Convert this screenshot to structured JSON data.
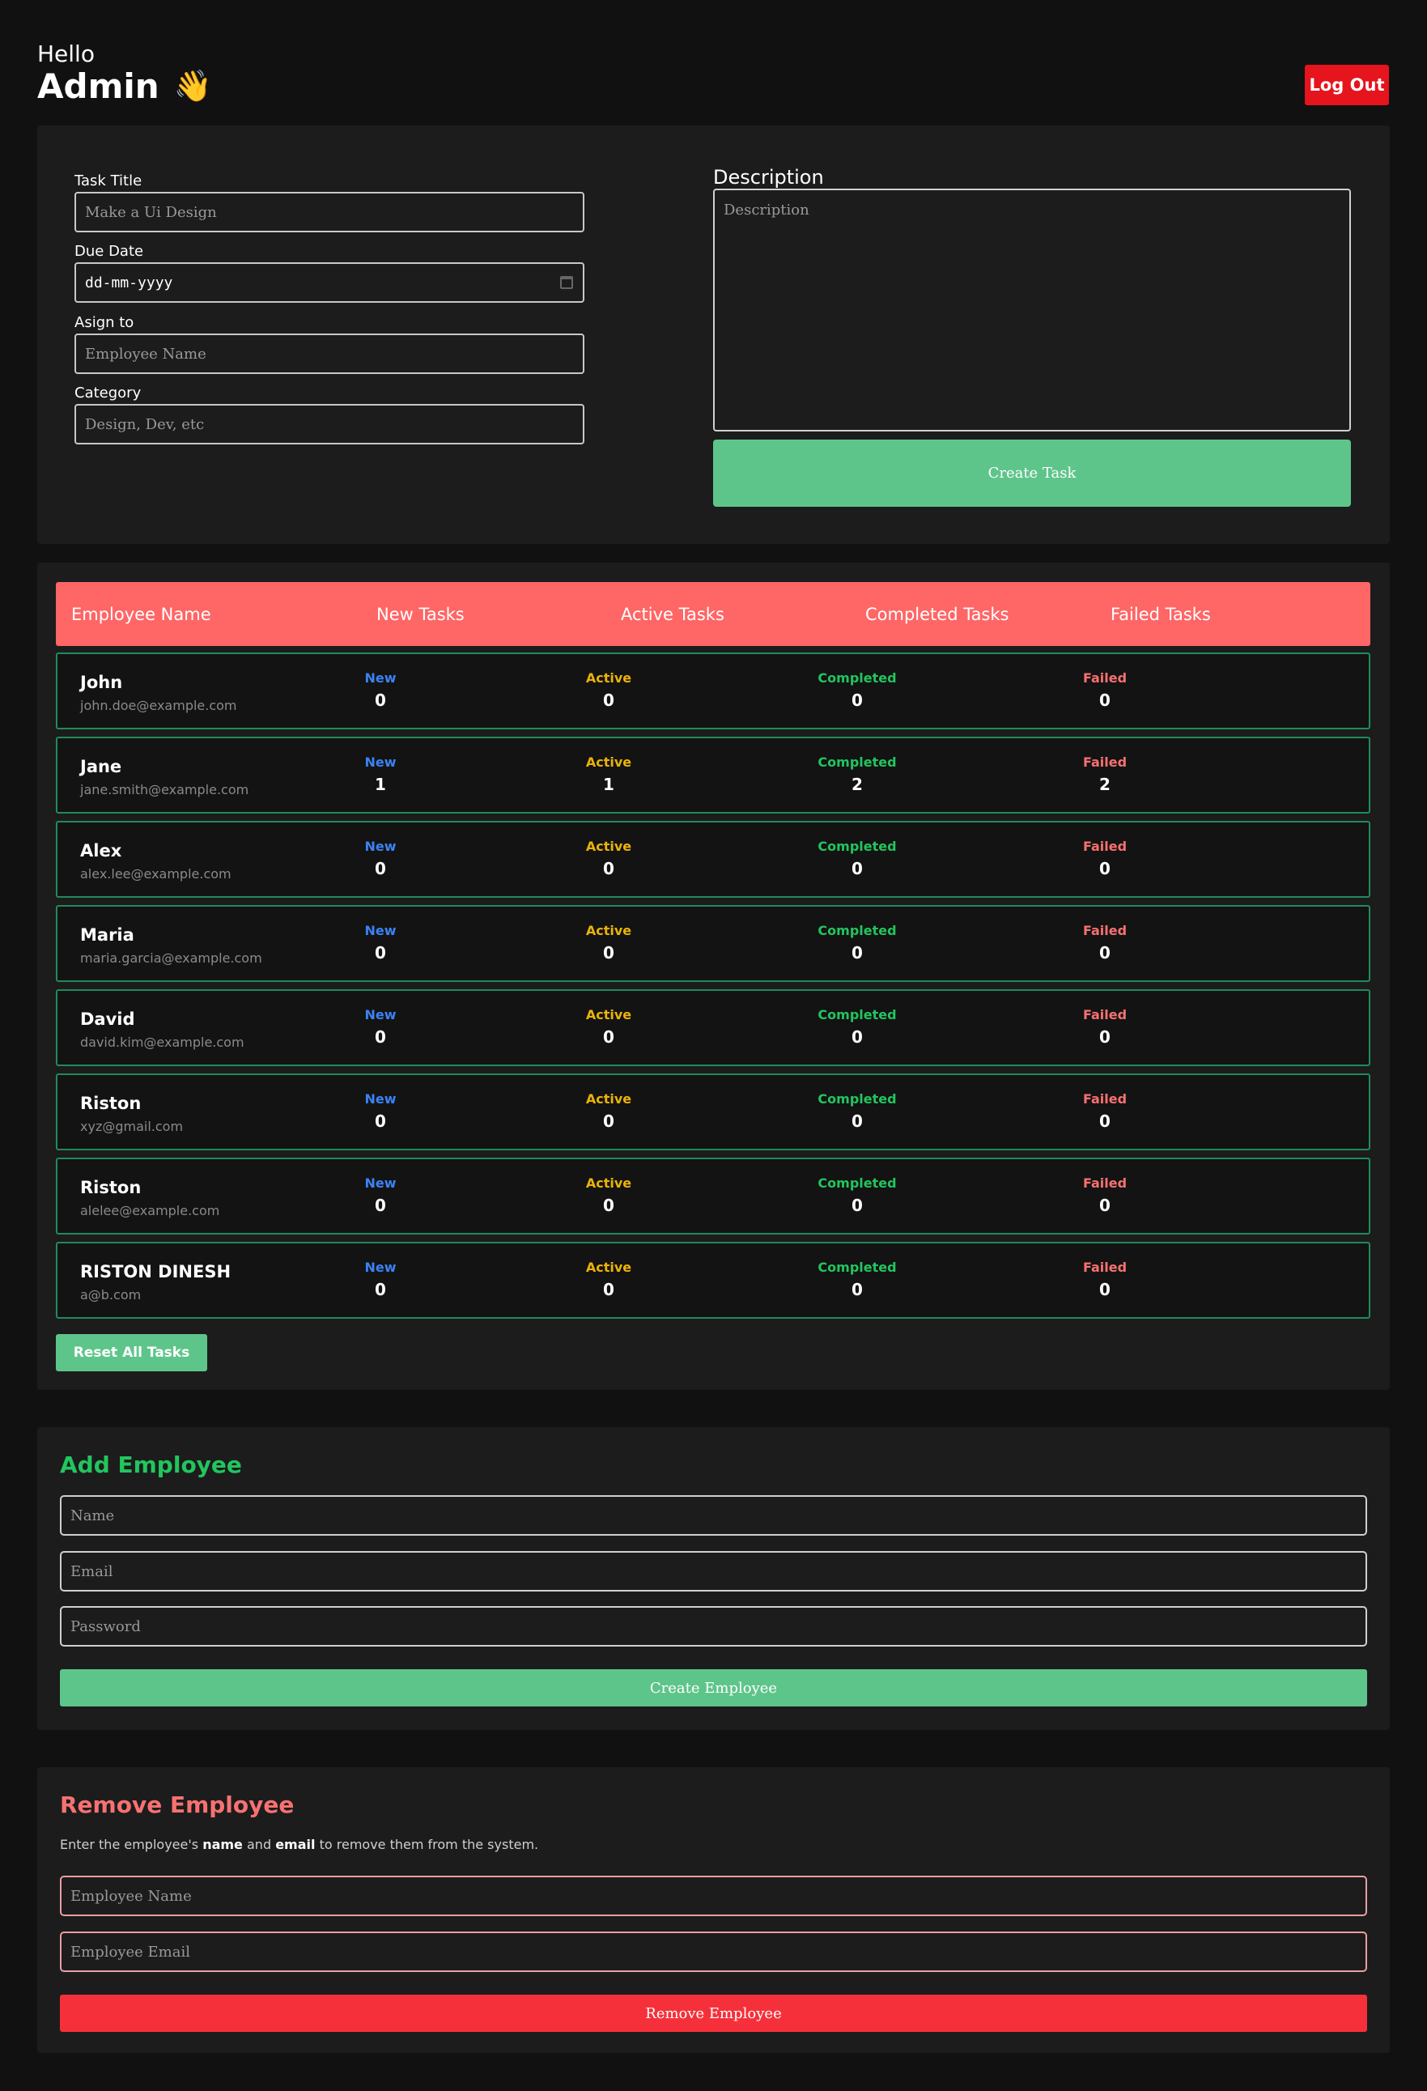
{
  "header": {
    "greeting": "Hello",
    "user": "Admin",
    "wave": "👋",
    "logout_label": "Log Out"
  },
  "task_form": {
    "title_label": "Task Title",
    "title_placeholder": "Make a Ui Design",
    "due_label": "Due Date",
    "due_placeholder": "dd-mm-yyyy",
    "assign_label": "Asign to",
    "assign_placeholder": "Employee Name",
    "category_label": "Category",
    "category_placeholder": "Design, Dev, etc",
    "description_label": "Description",
    "description_placeholder": "Description",
    "create_label": "Create Task"
  },
  "table": {
    "headers": [
      "Employee Name",
      "New Tasks",
      "Active Tasks",
      "Completed Tasks",
      "Failed Tasks"
    ],
    "stat_labels": {
      "new": "New",
      "active": "Active",
      "completed": "Completed",
      "failed": "Failed"
    },
    "rows": [
      {
        "name": "John",
        "email": "john.doe@example.com",
        "new": "0",
        "active": "0",
        "completed": "0",
        "failed": "0"
      },
      {
        "name": "Jane",
        "email": "jane.smith@example.com",
        "new": "1",
        "active": "1",
        "completed": "2",
        "failed": "2"
      },
      {
        "name": "Alex",
        "email": "alex.lee@example.com",
        "new": "0",
        "active": "0",
        "completed": "0",
        "failed": "0"
      },
      {
        "name": "Maria",
        "email": "maria.garcia@example.com",
        "new": "0",
        "active": "0",
        "completed": "0",
        "failed": "0"
      },
      {
        "name": "David",
        "email": "david.kim@example.com",
        "new": "0",
        "active": "0",
        "completed": "0",
        "failed": "0"
      },
      {
        "name": "Riston",
        "email": "xyz@gmail.com",
        "new": "0",
        "active": "0",
        "completed": "0",
        "failed": "0"
      },
      {
        "name": "Riston",
        "email": "alelee@example.com",
        "new": "0",
        "active": "0",
        "completed": "0",
        "failed": "0"
      },
      {
        "name": "RISTON DINESH",
        "email": "a@b.com",
        "new": "0",
        "active": "0",
        "completed": "0",
        "failed": "0"
      }
    ],
    "reset_label": "Reset All Tasks"
  },
  "add_employee": {
    "title": "Add Employee",
    "name_placeholder": "Name",
    "email_placeholder": "Email",
    "password_placeholder": "Password",
    "create_label": "Create Employee"
  },
  "remove_employee": {
    "title": "Remove Employee",
    "desc_prefix": "Enter the employee's",
    "desc_name": "name",
    "desc_and": "and",
    "desc_email": "email",
    "desc_suffix": "to remove them from the system.",
    "name_placeholder": "Employee Name",
    "email_placeholder": "Employee Email",
    "remove_label": "Remove Employee"
  },
  "colors": {
    "background": "#111111",
    "panel": "#1c1c1c",
    "accent_green": "#5ec58a",
    "header_red": "#ff6666",
    "danger": "#f6303a",
    "logout": "#e5141d"
  }
}
